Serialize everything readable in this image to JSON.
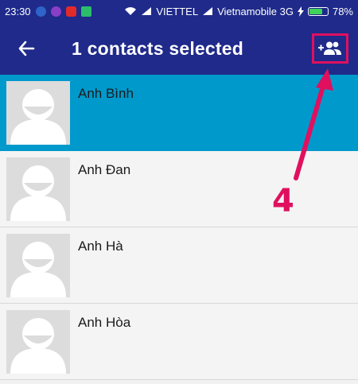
{
  "status_bar": {
    "time": "23:30",
    "carrier1": "VIETTEL",
    "carrier2": "Vietnamobile 3G",
    "battery": "78%",
    "battery_fraction": 0.78
  },
  "app_bar": {
    "title": "1 contacts selected",
    "back_icon": "arrow-left-icon",
    "action_icon": "add-contacts-icon"
  },
  "contacts": [
    {
      "name": "Anh Bình",
      "selected": true
    },
    {
      "name": "Anh Đan",
      "selected": false
    },
    {
      "name": "Anh Hà",
      "selected": false
    },
    {
      "name": "Anh Hòa",
      "selected": false
    }
  ],
  "annotation": {
    "step_number": "4"
  },
  "colors": {
    "primary": "#1f2a8a",
    "selected_row": "#0099cc",
    "annotation": "#e0105f",
    "row_bg": "#f4f4f4"
  }
}
